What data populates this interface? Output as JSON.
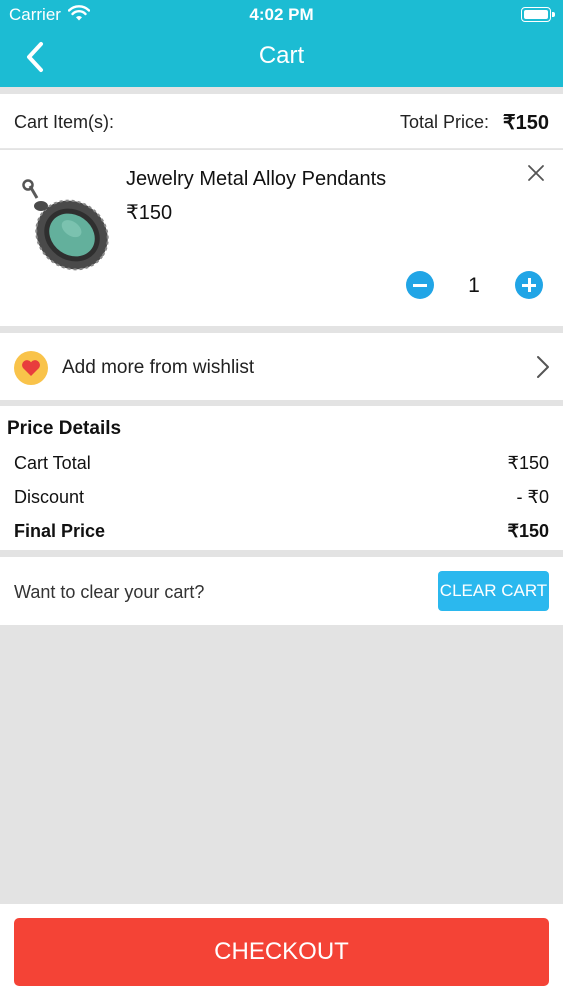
{
  "status_bar": {
    "carrier": "Carrier",
    "time": "4:02 PM"
  },
  "header": {
    "title": "Cart",
    "back_icon": "chevron-left-icon"
  },
  "summary": {
    "items_label": "Cart Item(s):",
    "total_label": "Total Price:",
    "total_value": "₹150"
  },
  "cart_items": [
    {
      "name": "Jewelry Metal Alloy Pendants",
      "price": "₹150",
      "quantity": "1"
    }
  ],
  "wishlist": {
    "label": "Add more from wishlist",
    "icon": "heart-icon"
  },
  "price_details": {
    "heading": "Price Details",
    "rows": [
      {
        "label": "Cart Total",
        "value": "₹150"
      },
      {
        "label": "Discount",
        "value": "- ₹0"
      },
      {
        "label": "Final Price",
        "value": "₹150"
      }
    ]
  },
  "clear_cart": {
    "question": "Want to clear your cart?",
    "button_label": "CLEAR CART"
  },
  "checkout": {
    "button_label": "CHECKOUT"
  },
  "colors": {
    "header": "#1cbcd3",
    "quantity_button": "#21a5e6",
    "clear_button": "#2bb8ee",
    "checkout_button": "#f44336"
  }
}
